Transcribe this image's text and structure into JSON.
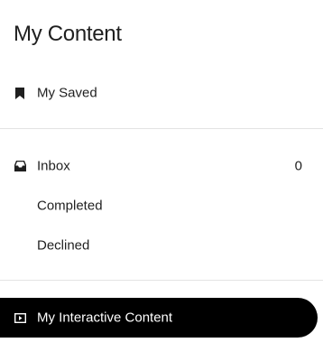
{
  "header": {
    "title": "My Content"
  },
  "sections": {
    "saved": {
      "label": "My Saved",
      "icon": "bookmark-icon"
    },
    "inbox": {
      "label": "Inbox",
      "count": "0",
      "icon": "inbox-icon"
    },
    "completed": {
      "label": "Completed"
    },
    "declined": {
      "label": "Declined"
    },
    "interactive": {
      "label": "My Interactive Content",
      "icon": "play-box-icon",
      "active": true
    }
  },
  "colors": {
    "active_bg": "#000000",
    "active_text": "#ffffff",
    "text": "#1f1f1f",
    "divider": "#e3e3e3"
  }
}
